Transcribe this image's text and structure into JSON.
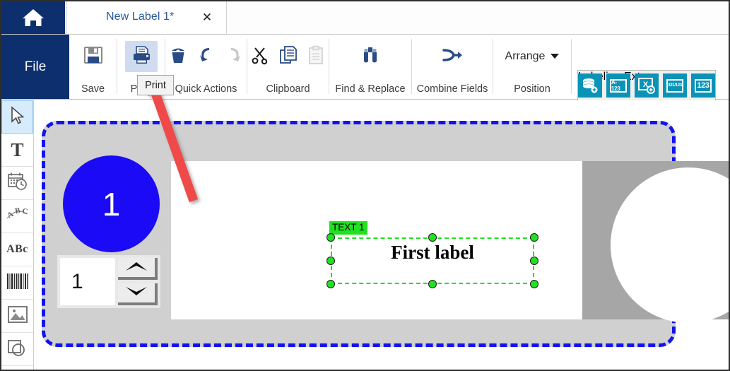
{
  "window": {
    "title_tab": "New Label 1*",
    "home_icon": "home-icon",
    "close_icon": "close-icon"
  },
  "ribbon": {
    "file_label": "File",
    "groups": [
      {
        "name": "save",
        "label": "Save",
        "items": [
          {
            "icon": "floppy-disk-save-icon",
            "state": "normal"
          }
        ]
      },
      {
        "name": "print",
        "label": "Print",
        "items": [
          {
            "icon": "printer-icon",
            "state": "highlighted"
          }
        ]
      },
      {
        "name": "quick-actions",
        "label": "Quick Actions",
        "items": [
          {
            "icon": "trash-delete-icon",
            "state": "normal"
          },
          {
            "icon": "undo-arrow-icon",
            "state": "normal"
          },
          {
            "icon": "redo-arrow-icon",
            "state": "disabled"
          }
        ]
      },
      {
        "name": "clipboard",
        "label": "Clipboard",
        "items": [
          {
            "icon": "scissors-cut-icon",
            "state": "normal"
          },
          {
            "icon": "copy-pages-icon",
            "state": "normal"
          },
          {
            "icon": "paste-clipboard-icon",
            "state": "disabled"
          }
        ]
      },
      {
        "name": "find-replace",
        "label": "Find & Replace",
        "items": [
          {
            "icon": "binoculars-icon",
            "state": "normal"
          }
        ]
      },
      {
        "name": "combine-fields",
        "label": "Combine Fields",
        "items": [
          {
            "icon": "merge-arrow-icon",
            "state": "normal"
          }
        ]
      },
      {
        "name": "position",
        "label": "Position",
        "arrange_label": "Arrange",
        "items": [
          {
            "icon": "chevron-down-icon",
            "state": "normal"
          }
        ]
      }
    ],
    "labeling_extras": {
      "label": "Labeling Extras",
      "buttons": [
        {
          "icon": "database-add-icon",
          "text": ""
        },
        {
          "icon": "alpha-counter-icon",
          "text": "A-123"
        },
        {
          "icon": "variable-add-icon",
          "text": "X"
        },
        {
          "icon": "date-serial-icon",
          "text": "321/123"
        },
        {
          "icon": "numeric-counter-icon",
          "text": "123"
        }
      ]
    }
  },
  "tooltip": {
    "text": "Print"
  },
  "toolrail": {
    "tools": [
      {
        "name": "select-arrow-tool",
        "icon": "cursor-arrow-icon",
        "selected": true
      },
      {
        "name": "text-tool",
        "icon": "text-t-icon",
        "selected": false
      },
      {
        "name": "date-time-tool",
        "icon": "calendar-clock-icon",
        "selected": false
      },
      {
        "name": "curved-text-tool",
        "icon": "curved-abc-icon",
        "selected": false
      },
      {
        "name": "paragraph-text-tool",
        "icon": "abc-text-icon",
        "selected": false
      },
      {
        "name": "barcode-tool",
        "icon": "barcode-icon",
        "selected": false
      },
      {
        "name": "image-tool",
        "icon": "picture-image-icon",
        "selected": false
      },
      {
        "name": "shape-tool",
        "icon": "shape-square-circle-icon",
        "selected": false
      }
    ]
  },
  "canvas": {
    "label": {
      "counter_circle_value": "1",
      "counter_field_value": "1",
      "spinner_up_icon": "caret-up-icon",
      "spinner_down_icon": "caret-down-icon"
    },
    "selected_object": {
      "tag": "TEXT 1",
      "text": "First label",
      "handles": 8
    }
  },
  "annotation": {
    "arrow": "red-arrow-pointing-to-print"
  },
  "colors": {
    "navy": "#0d2f6e",
    "tab_title": "#2b5797",
    "teal": "#0a93b7",
    "label_border_blue": "#1312f0",
    "selection_green": "#22e022",
    "arrow_red": "#ee4444",
    "circle_blue": "#1a0af5"
  }
}
